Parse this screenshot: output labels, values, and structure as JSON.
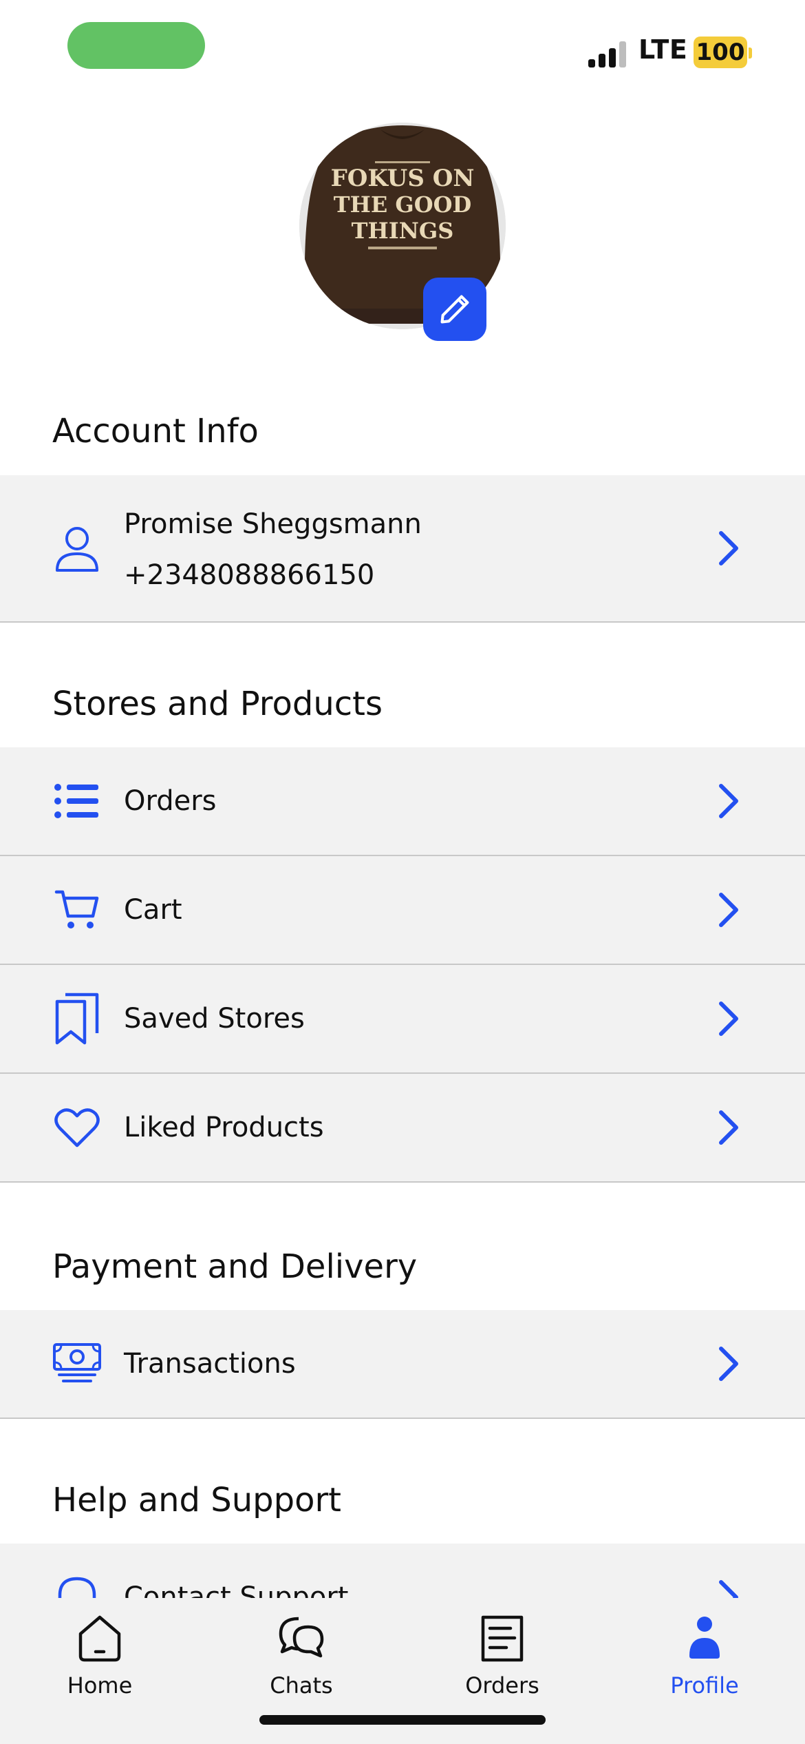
{
  "status_bar": {
    "network": "LTE",
    "battery": "100"
  },
  "profile": {
    "avatar_text_lines": [
      "FOKUS ON",
      "THE GOOD",
      "THINGS"
    ],
    "edit_icon": "pencil-icon"
  },
  "sections": {
    "account_info": {
      "title": "Account Info",
      "name": "Promise Sheggsmann",
      "phone": "+2348088866150",
      "icon": "user-icon"
    },
    "stores_products": {
      "title": "Stores and Products",
      "items": [
        {
          "label": "Orders",
          "icon": "list-icon"
        },
        {
          "label": "Cart",
          "icon": "cart-icon"
        },
        {
          "label": "Saved Stores",
          "icon": "bookmarks-icon"
        },
        {
          "label": "Liked Products",
          "icon": "heart-icon"
        }
      ]
    },
    "payment_delivery": {
      "title": "Payment and Delivery",
      "items": [
        {
          "label": "Transactions",
          "icon": "money-icon"
        }
      ]
    },
    "help_support": {
      "title": "Help and Support",
      "items": [
        {
          "label": "Contact Support",
          "icon": "headset-icon"
        }
      ]
    }
  },
  "tab_bar": {
    "tabs": [
      {
        "label": "Home",
        "icon": "home-icon",
        "active": false
      },
      {
        "label": "Chats",
        "icon": "chat-icon",
        "active": false
      },
      {
        "label": "Orders",
        "icon": "receipt-icon",
        "active": false
      },
      {
        "label": "Profile",
        "icon": "profile-icon",
        "active": true
      }
    ]
  },
  "colors": {
    "accent": "#2350f0",
    "row_background": "#f2f2f2",
    "status_pill": "#62c264",
    "battery": "#f4cc3a"
  }
}
